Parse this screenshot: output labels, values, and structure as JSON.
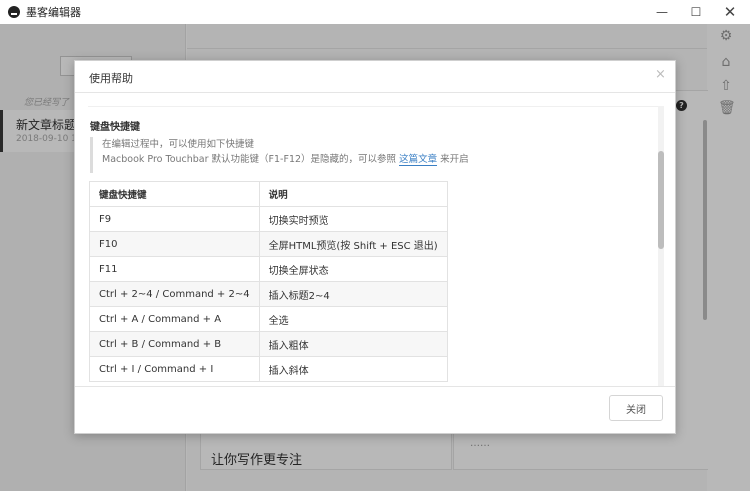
{
  "window": {
    "title": "墨客编辑器",
    "minimize_glyph": "—",
    "maximize_glyph": "☐",
    "close_glyph": "✕"
  },
  "sidebar": {
    "saved_text": "您已经写了",
    "article": {
      "title": "新文章标题",
      "date": "2018-09-10 10"
    }
  },
  "editor": {
    "line_text": "让你写作更专注",
    "preview_help_glyph": "?",
    "preview_bottom_text": "……"
  },
  "rail": {
    "icons": [
      "gear-icon",
      "tag-icon",
      "share-icon",
      "trash-icon"
    ],
    "glyphs": [
      "⚙",
      "⌂",
      "⇧",
      "🗑"
    ]
  },
  "dialog": {
    "title": "使用帮助",
    "close_glyph": "×",
    "section_title": "键盘快捷键",
    "note_line1": "在编辑过程中，可以使用如下快捷键",
    "note_line2_prefix": "Macbook Pro Touchbar 默认功能键（F1-F12）是隐藏的，可以参照",
    "note_link": "这篇文章",
    "note_line2_suffix": "来开启",
    "table": {
      "headers": [
        "键盘快捷键",
        "说明"
      ],
      "rows": [
        [
          "F9",
          "切换实时预览"
        ],
        [
          "F10",
          "全屏HTML预览(按 Shift + ESC 退出)"
        ],
        [
          "F11",
          "切换全屏状态"
        ],
        [
          "Ctrl + 2~4 / Command + 2~4",
          "插入标题2~4"
        ],
        [
          "Ctrl + A / Command + A",
          "全选"
        ],
        [
          "Ctrl + B / Command + B",
          "插入粗体"
        ],
        [
          "Ctrl + I / Command + I",
          "插入斜体"
        ]
      ]
    },
    "close_button_label": "关闭"
  }
}
